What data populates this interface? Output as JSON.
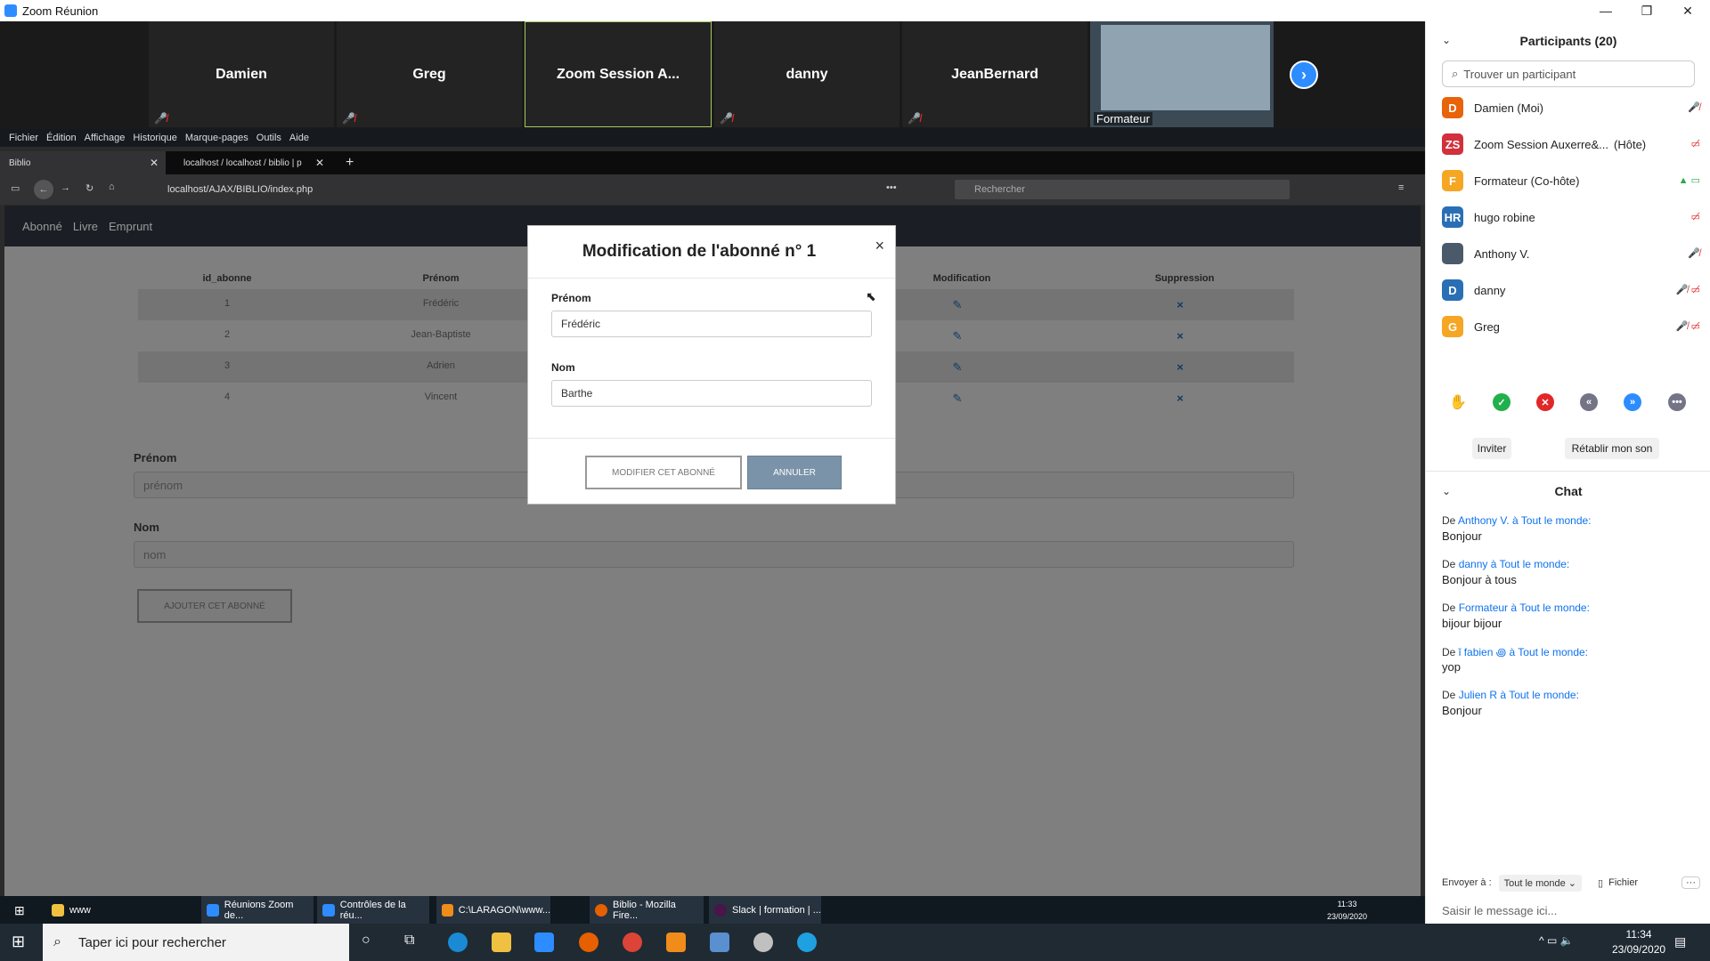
{
  "zoom_window": {
    "title": "Zoom Réunion",
    "min": "—",
    "max": "❐",
    "close": "✕"
  },
  "video_tiles": [
    {
      "name": "Damien"
    },
    {
      "name": "Greg"
    },
    {
      "name": "Zoom Session A..."
    },
    {
      "name": "danny"
    },
    {
      "name": "JeanBernard"
    }
  ],
  "video_presenter": {
    "name": "Formateur"
  },
  "firefox": {
    "menu": [
      "Fichier",
      "Édition",
      "Affichage",
      "Historique",
      "Marque-pages",
      "Outils",
      "Aide"
    ],
    "tabs": [
      {
        "label": "Biblio"
      },
      {
        "label": "localhost / localhost / biblio | p"
      }
    ],
    "new_tab": "+",
    "url": "localhost/AJAX/BIBLIO/index.php",
    "search_placeholder": "Rechercher",
    "more": "•••"
  },
  "site": {
    "nav": [
      "Abonné",
      "Livre",
      "Emprunt"
    ],
    "table": {
      "headers": [
        "id_abonne",
        "Prénom",
        "Modification",
        "Suppression"
      ],
      "rows": [
        {
          "id": "1",
          "prenom": "Frédéric"
        },
        {
          "id": "2",
          "prenom": "Jean-Baptiste"
        },
        {
          "id": "3",
          "prenom": "Adrien"
        },
        {
          "id": "4",
          "prenom": "Vincent"
        }
      ]
    },
    "form": {
      "prenom_label": "Prénom",
      "prenom_placeholder": "prénom",
      "nom_label": "Nom",
      "nom_placeholder": "nom",
      "submit": "AJOUTER CET ABONNÉ"
    }
  },
  "modal": {
    "title": "Modification de l'abonné n° 1",
    "close": "×",
    "prenom_label": "Prénom",
    "prenom_value": "Frédéric",
    "nom_label": "Nom",
    "nom_value": "Barthe",
    "modify": "MODIFIER CET ABONNÉ",
    "cancel": "ANNULER"
  },
  "inner_taskbar": {
    "items": [
      "www",
      "Réunions Zoom de...",
      "Contrôles de la réu...",
      "C:\\LARAGON\\www...",
      "Biblio - Mozilla Fire...",
      "Slack | formation | ..."
    ],
    "time": "11:33",
    "date": "23/09/2020"
  },
  "participants": {
    "title": "Participants (20)",
    "search_placeholder": "Trouver un participant",
    "list": [
      {
        "initials": "D",
        "name": "Damien (Moi)",
        "color": "#e8630a"
      },
      {
        "initials": "ZS",
        "name": "Zoom Session Auxerre&...",
        "role": "(Hôte)",
        "color": "#d1303c"
      },
      {
        "initials": "F",
        "name": "Formateur (Co-hôte)",
        "color": "#f5a623"
      },
      {
        "initials": "HR",
        "name": "hugo robine",
        "color": "#2a6fb5"
      },
      {
        "initials": "",
        "name": "Anthony V.",
        "color": "#4a5a6a"
      },
      {
        "initials": "D",
        "name": "danny",
        "color": "#2a6fb5"
      },
      {
        "initials": "G",
        "name": "Greg",
        "color": "#f5a623"
      }
    ],
    "invite": "Inviter",
    "unmute": "Rétablir mon son"
  },
  "chat": {
    "title": "Chat",
    "messages": [
      {
        "prefix": "De",
        "from": "Anthony V.",
        "mid": "à",
        "to": "Tout le monde:",
        "text": "Bonjour"
      },
      {
        "prefix": "De",
        "from": "danny",
        "mid": "à",
        "to": "Tout le monde:",
        "text": "Bonjour à tous"
      },
      {
        "prefix": "De",
        "from": "Formateur",
        "mid": "à",
        "to": "Tout le monde:",
        "text": "bijour bijour"
      },
      {
        "prefix": "De",
        "from": "ǐ fabien ꩜",
        "mid": "à",
        "to": "Tout le monde:",
        "text": "yop"
      },
      {
        "prefix": "De",
        "from": "Julien R",
        "mid": "à",
        "to": "Tout le monde:",
        "text": "Bonjour"
      }
    ],
    "send_to_label": "Envoyer à :",
    "send_to_value": "Tout le monde",
    "file": "Fichier",
    "input_placeholder": "Saisir le message ici..."
  },
  "taskbar": {
    "search": "Taper ici pour rechercher",
    "time": "11:34",
    "date": "23/09/2020"
  }
}
